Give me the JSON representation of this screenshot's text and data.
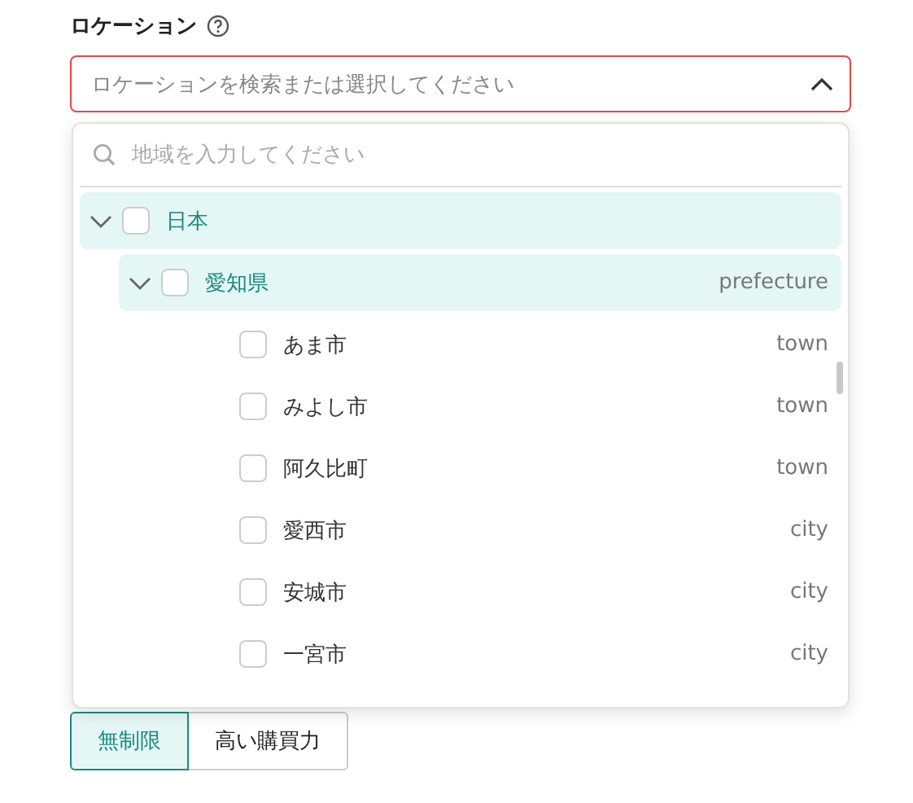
{
  "field": {
    "label": "ロケーション",
    "placeholder": "ロケーションを検索または選択してください",
    "invalid": true,
    "open": true
  },
  "dropdown": {
    "search_placeholder": "地域を入力してください",
    "tree": [
      {
        "label": "日本",
        "expanded": true,
        "checked": false,
        "selected": true,
        "children": [
          {
            "label": "愛知県",
            "type": "prefecture",
            "expanded": true,
            "checked": false,
            "selected": true,
            "children": [
              {
                "label": "あま市",
                "type": "town",
                "checked": false,
                "selected": false
              },
              {
                "label": "みよし市",
                "type": "town",
                "checked": false,
                "selected": false
              },
              {
                "label": "阿久比町",
                "type": "town",
                "checked": false,
                "selected": false
              },
              {
                "label": "愛西市",
                "type": "city",
                "checked": false,
                "selected": false
              },
              {
                "label": "安城市",
                "type": "city",
                "checked": false,
                "selected": false
              },
              {
                "label": "一宮市",
                "type": "city",
                "checked": false,
                "selected": false
              }
            ]
          }
        ]
      }
    ]
  },
  "segments": [
    {
      "label": "無制限",
      "selected": true
    },
    {
      "label": "高い購買力",
      "selected": false
    }
  ]
}
